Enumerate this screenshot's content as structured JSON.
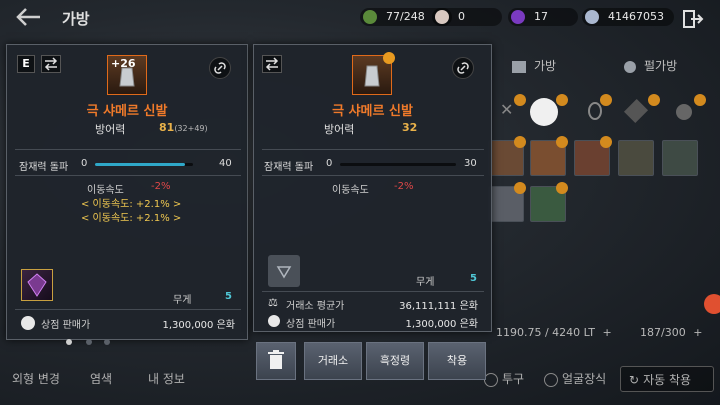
{
  "topbar": {
    "title": "가방",
    "currencies": [
      {
        "icon": "weight-icon",
        "value": "77/248",
        "color": "#7ab85a"
      },
      {
        "icon": "pearl-icon",
        "value": "0",
        "color": "#e8d8d0"
      },
      {
        "icon": "shard-icon",
        "value": "17",
        "color": "#8a4ad0"
      },
      {
        "icon": "silver-icon",
        "value": "41467053",
        "color": "#c8d0e0"
      }
    ]
  },
  "background": {
    "tabs": [
      "가방",
      "펄가방"
    ],
    "weight_text": "1190.75 / 4240 LT",
    "slots_text": "187/300",
    "buttons": [
      "외형 변경",
      "염색",
      "내 정보",
      "투구",
      "얼굴장식",
      "자동 착용"
    ]
  },
  "left_panel": {
    "e_badge": "E",
    "enhance_level": "+26",
    "item_name": "극 샤메르 신발",
    "stat_label": "방어력",
    "stat_value": "81",
    "stat_detail": "(32+49)",
    "potential_label": "잠재력 돌파",
    "potential_min": "0",
    "potential_max": "40",
    "potential_fill": 0.92,
    "effects": [
      {
        "text": "이동속도",
        "value": "-2%"
      },
      {
        "text": "< 이동속도: +2.1% >"
      },
      {
        "text": "< 이동속도: +2.1% >"
      }
    ],
    "weight_label": "무게",
    "weight_value": "5",
    "shop_label": "상점 판매가",
    "shop_value": "1,300,000 은화"
  },
  "right_panel": {
    "item_name": "극 샤메르 신발",
    "stat_label": "방어력",
    "stat_value": "32",
    "potential_label": "잠재력 돌파",
    "potential_min": "0",
    "potential_max": "30",
    "potential_fill": 0,
    "effect_text": "이동속도",
    "effect_value": "-2%",
    "weight_label": "무게",
    "weight_value": "5",
    "market_label": "거래소 평균가",
    "market_value": "36,111,111 은화",
    "shop_label": "상점 판매가",
    "shop_value": "1,300,000 은화"
  },
  "actions": {
    "market": "거래소",
    "black_spirit": "흑정령",
    "equip": "착용"
  }
}
